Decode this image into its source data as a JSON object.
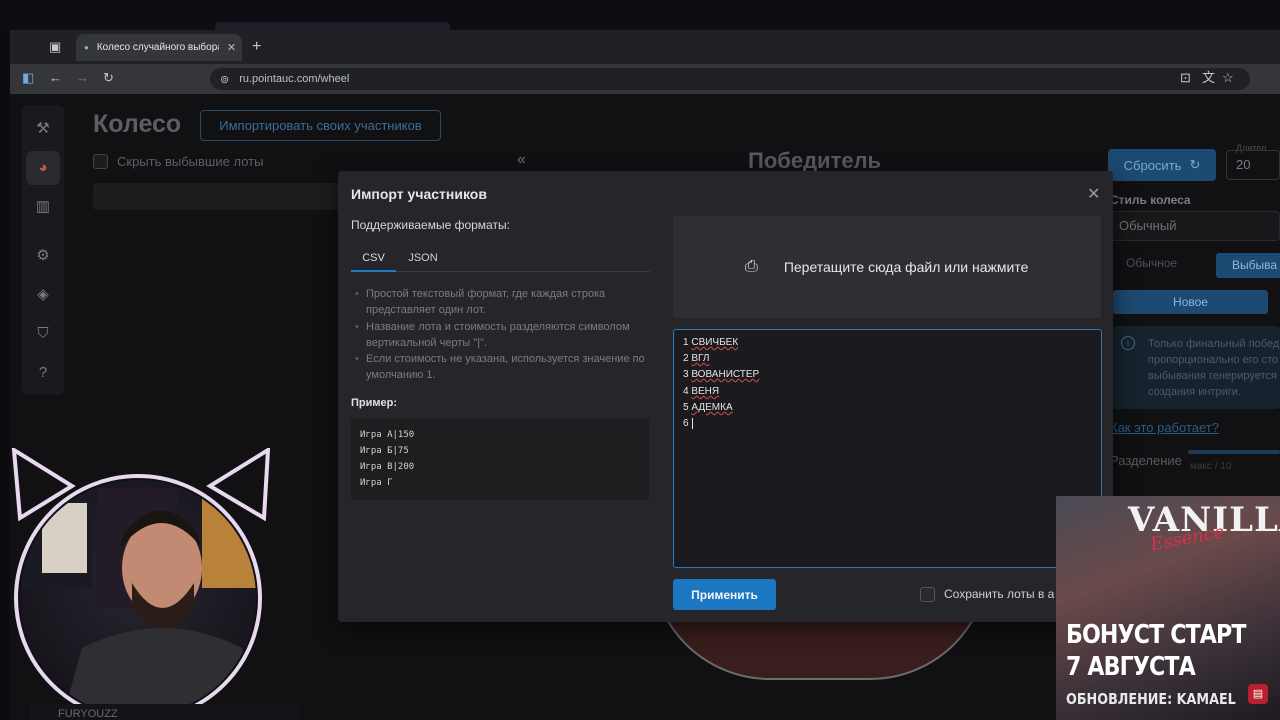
{
  "browser": {
    "tab_title": "Колесо случайного выбора – I",
    "url": "ru.pointauc.com/wheel"
  },
  "page": {
    "title": "Колесо",
    "import_button": "Импортировать своих участников",
    "hide_label": "Скрыть выбывшие лоты",
    "winner_title": "Победитель",
    "reset_button": "Сбросить",
    "duration_label": "Длител",
    "duration_value": "20",
    "wheel_style_label": "Стиль колеса",
    "wheel_style_value": "Обычный",
    "mode_normal": "Обычное",
    "mode_drop": "Выбыва",
    "new_button": "Новое",
    "info_lines": [
      "Только финальный побед",
      "пропорционально его сто",
      "выбывания генерируется",
      "создания интриги."
    ],
    "how_link": "Как это работает?",
    "split_label": "Разделение",
    "split_hint": "макс / 10"
  },
  "modal": {
    "title": "Импорт участников",
    "formats_label": "Поддерживаемые форматы:",
    "tabs": [
      "CSV",
      "JSON"
    ],
    "bullets": [
      "Простой текстовый формат, где каждая строка представляет один лот.",
      "Название лота и стоимость разделяются символом вертикальной черты \"|\".",
      "Если стоимость не указана, используется значение по умолчанию 1."
    ],
    "example_label": "Пример:",
    "example_lines": [
      "Игра А|150",
      "Игра Б|75",
      "Игра В|200",
      "Игра Г"
    ],
    "dropzone_text": "Перетащите сюда файл или нажмите",
    "textarea_lines": [
      {
        "num": "1",
        "name": "СВИЧБЕК"
      },
      {
        "num": "2",
        "name": "ВГЛ"
      },
      {
        "num": "3",
        "name": "ВОВАНИСТЕР"
      },
      {
        "num": "4",
        "name": "ВЕНЯ"
      },
      {
        "num": "5",
        "name": "АДЕМКА"
      },
      {
        "num": "6",
        "name": ""
      }
    ],
    "apply_button": "Применить",
    "save_label": "Сохранить лоты в а"
  },
  "overlay": {
    "ad_brand": "VANILLA",
    "ad_sub": "Essence",
    "ad_line1": "БОНУСТ СТАРТ",
    "ad_line2": "7 АВГУСТА",
    "ad_line3": "ОБНОВЛЕНИЕ: KAMAEL",
    "streamer_name": "FURYOUZZ"
  }
}
